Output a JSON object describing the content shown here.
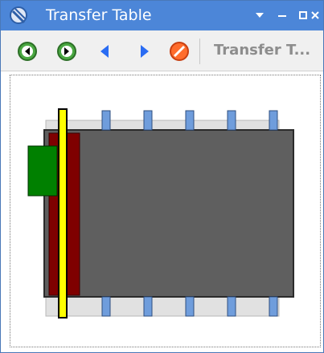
{
  "window": {
    "title": "Transfer Table",
    "colors": {
      "titlebar": "#4c86d8",
      "toolbar": "#f0f0f0",
      "track_gray": "#5f5f5f",
      "bridge": "#e1e1e1",
      "pier": "#6f9ddc",
      "bridge_deck": "#7f0000",
      "bridge_rail": "#ffff00",
      "operator_house": "#008000"
    }
  },
  "toolbar": {
    "label": "Transfer T...",
    "buttons": [
      {
        "name": "first",
        "icon": "circle-left-icon"
      },
      {
        "name": "next",
        "icon": "circle-right-icon"
      },
      {
        "name": "previous",
        "icon": "triangle-left-icon"
      },
      {
        "name": "forward",
        "icon": "triangle-right-icon"
      },
      {
        "name": "clear",
        "icon": "stop-icon"
      }
    ]
  }
}
